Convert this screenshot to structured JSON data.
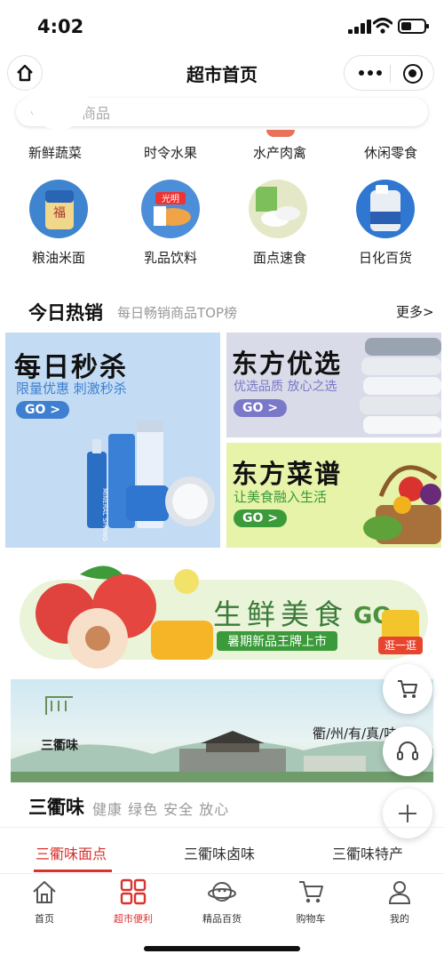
{
  "status_bar": {
    "time": "4:02"
  },
  "nav": {
    "title": "超市首页"
  },
  "search": {
    "placeholder": "搜索商品"
  },
  "categories_row1": [
    "新鲜蔬菜",
    "时令水果",
    "水产肉禽",
    "休闲零食"
  ],
  "categories_row2": [
    {
      "label": "粮油米面",
      "icon": "rice-bag-icon"
    },
    {
      "label": "乳品饮料",
      "icon": "bread-milk-icon"
    },
    {
      "label": "面点速食",
      "icon": "dumplings-icon"
    },
    {
      "label": "日化百货",
      "icon": "detergent-icon"
    }
  ],
  "hot": {
    "title": "今日热销",
    "subtitle": "每日畅销商品TOP榜",
    "more": "更多>"
  },
  "cards": {
    "miaosha": {
      "title": "每日秒杀",
      "subtitle": "限量优惠 刺激秒杀",
      "go": "GO >",
      "brand": "MINERAL SPRING"
    },
    "youxuan": {
      "title": "东方优选",
      "subtitle": "优选品质 放心之选",
      "go": "GO >"
    },
    "caipu": {
      "title": "东方菜谱",
      "subtitle": "让美食融入生活",
      "go": "GO >"
    }
  },
  "fresh_banner": {
    "title": "生鲜美食",
    "subtitle": "暑期新品王牌上市",
    "go": "GO",
    "badge": "逛一逛"
  },
  "quzhou_banner": {
    "logo_text": "三衢味",
    "slogan": "衢/州/有/真/味"
  },
  "sxw": {
    "title": "三衢味",
    "subtitle": "健康 绿色 安全 放心"
  },
  "subtabs": [
    "三衢味面点",
    "三衢味卤味",
    "三衢味特产"
  ],
  "tabbar": [
    "首页",
    "超市便利",
    "精品百货",
    "购物车",
    "我的"
  ],
  "colors": {
    "accent": "#d9322f",
    "go_blue": "#3f7fd1",
    "go_purple": "#7a78c8",
    "go_green": "#3b9a3a"
  }
}
